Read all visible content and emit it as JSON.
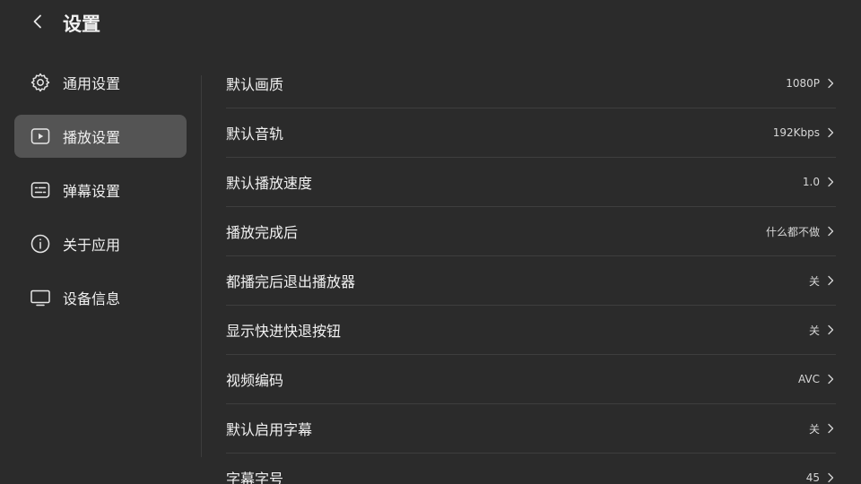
{
  "header": {
    "title": "设置"
  },
  "sidebar": {
    "items": [
      {
        "label": "通用设置",
        "icon": "gear-icon"
      },
      {
        "label": "播放设置",
        "icon": "play-icon",
        "active": true
      },
      {
        "label": "弹幕设置",
        "icon": "danmaku-icon"
      },
      {
        "label": "关于应用",
        "icon": "info-icon"
      },
      {
        "label": "设备信息",
        "icon": "monitor-icon"
      }
    ]
  },
  "settings": {
    "rows": [
      {
        "label": "默认画质",
        "value": "1080P"
      },
      {
        "label": "默认音轨",
        "value": "192Kbps"
      },
      {
        "label": "默认播放速度",
        "value": "1.0"
      },
      {
        "label": "播放完成后",
        "value": "什么都不做"
      },
      {
        "label": "都播完后退出播放器",
        "value": "关"
      },
      {
        "label": "显示快进快退按钮",
        "value": "关"
      },
      {
        "label": "视频编码",
        "value": "AVC"
      },
      {
        "label": "默认启用字幕",
        "value": "关"
      },
      {
        "label": "字幕字号",
        "value": "45"
      }
    ]
  },
  "colors": {
    "background": "#2b2b2b",
    "active_item": "#545454",
    "text": "#f2f2f2"
  }
}
